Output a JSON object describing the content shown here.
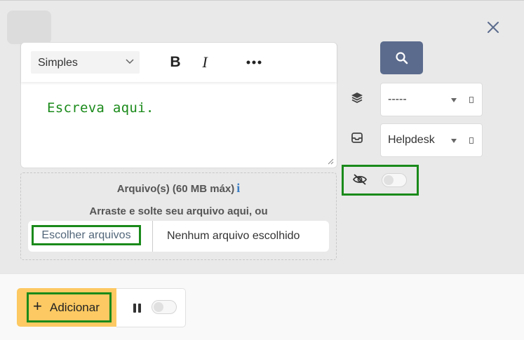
{
  "editor": {
    "style_select": "Simples",
    "bold_label": "B",
    "italic_label": "I",
    "more_label": "•••",
    "placeholder": "Escreva aqui."
  },
  "upload": {
    "title": "Arquivo(s) (60 MB máx)",
    "info_icon": "i",
    "hint": "Arraste e solte seu arquivo aqui, ou",
    "choose_button": "Escolher arquivos",
    "no_file": "Nenhum arquivo escolhido"
  },
  "sidebar": {
    "layers_select": "-----",
    "inbox_select": "Helpdesk",
    "hidden_toggle": false
  },
  "footer": {
    "add_button": "Adicionar",
    "plus_icon": "+",
    "pause_toggle": false
  },
  "colors": {
    "accent_green": "#1a8a1a",
    "search_button": "#5b6b8d",
    "add_button": "#fcc962"
  },
  "icons": [
    "close-icon",
    "chevron-down-icon",
    "more-icon",
    "resize-icon",
    "search-icon",
    "layers-icon",
    "inbox-icon",
    "eye-off-icon",
    "pause-icon",
    "info-icon"
  ]
}
